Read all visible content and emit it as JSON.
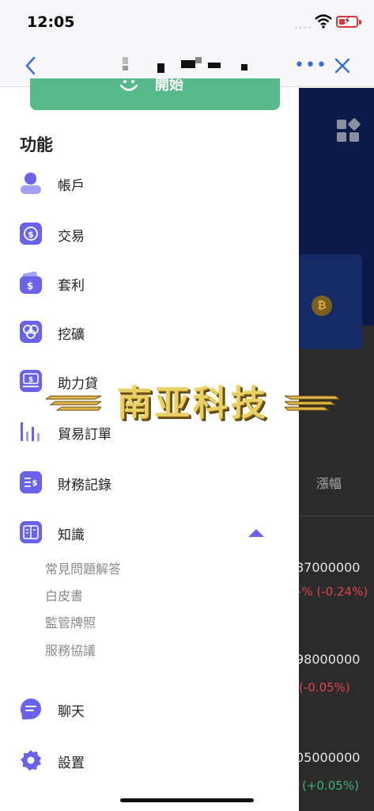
{
  "status_bar": {
    "time": "12:05",
    "signal": "••••"
  },
  "nav": {
    "back_icon": "chevron-left-icon",
    "more_label": "•••",
    "close_icon": "close-icon"
  },
  "drawer": {
    "start_button_label": "開始",
    "section_title": "功能",
    "items": [
      {
        "label": "帳戶",
        "icon": "user-icon"
      },
      {
        "label": "交易",
        "icon": "exchange-icon"
      },
      {
        "label": "套利",
        "icon": "wallet-icon"
      },
      {
        "label": "挖礦",
        "icon": "mining-icon"
      },
      {
        "label": "助力貸",
        "icon": "loan-icon"
      },
      {
        "label": "貿易訂單",
        "icon": "bar-chart-icon"
      },
      {
        "label": "財務記錄",
        "icon": "finance-record-icon"
      },
      {
        "label": "知識",
        "icon": "book-icon"
      },
      {
        "label": "聊天",
        "icon": "chat-icon"
      },
      {
        "label": "設置",
        "icon": "settings-icon"
      }
    ],
    "knowledge_sub_items": [
      "常見問題解答",
      "白皮書",
      "監管牌照",
      "服務協議"
    ]
  },
  "background_page": {
    "column_header": "漲幅",
    "rows": [
      {
        "price": "87000000",
        "change": "-% (-0.24%)",
        "direction": "down"
      },
      {
        "price": "98000000",
        "change": "(-0.05%)",
        "direction": "down"
      },
      {
        "price": "05000000",
        "change": "(+0.05%)",
        "direction": "up"
      }
    ]
  },
  "watermark": {
    "text": "南亚科技"
  },
  "colors": {
    "accent": "#6a63ea",
    "start_button": "#56b98a",
    "negative": "#e0454c",
    "positive": "#3fb37a",
    "nav_link": "#3a6fd8"
  }
}
